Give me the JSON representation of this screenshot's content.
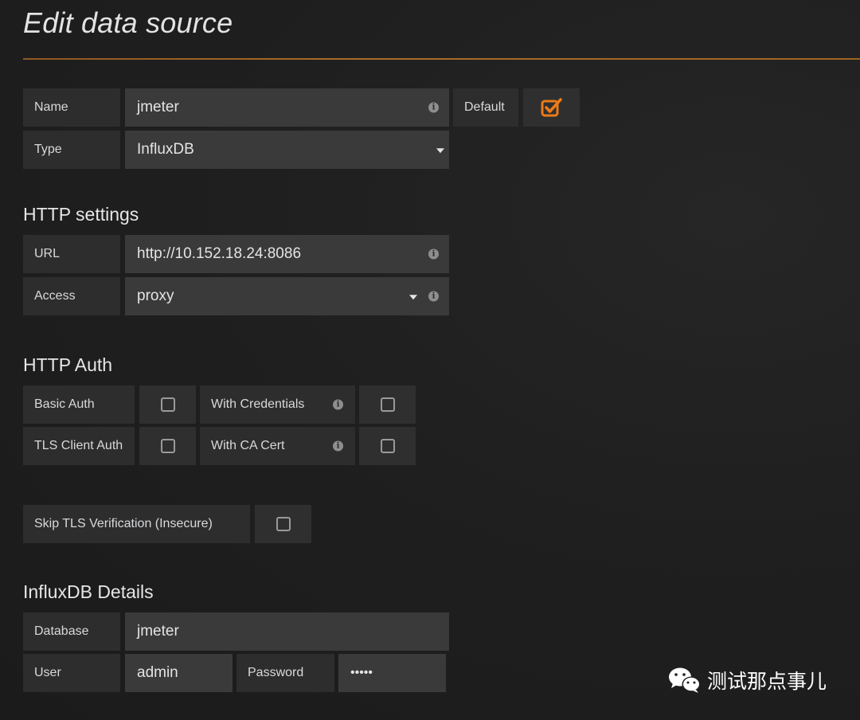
{
  "page": {
    "title": "Edit data source"
  },
  "general": {
    "name_label": "Name",
    "name_value": "jmeter",
    "default_label": "Default",
    "default_checked": true,
    "type_label": "Type",
    "type_value": "InfluxDB"
  },
  "http_settings": {
    "heading": "HTTP settings",
    "url_label": "URL",
    "url_value": "http://10.152.18.24:8086",
    "access_label": "Access",
    "access_value": "proxy"
  },
  "http_auth": {
    "heading": "HTTP Auth",
    "basic_auth_label": "Basic Auth",
    "with_credentials_label": "With Credentials",
    "tls_client_auth_label": "TLS Client Auth",
    "with_ca_cert_label": "With CA Cert",
    "skip_tls_label": "Skip TLS Verification (Insecure)"
  },
  "influxdb_details": {
    "heading": "InfluxDB Details",
    "database_label": "Database",
    "database_value": "jmeter",
    "user_label": "User",
    "user_value": "admin",
    "password_label": "Password",
    "password_value": "•••••"
  },
  "watermark": {
    "text": "测试那点事儿",
    "icon": "wechat-icon"
  },
  "colors": {
    "accent": "#eb7b18",
    "label_bg": "#2d2d2e",
    "input_bg": "#3a3a3a"
  }
}
